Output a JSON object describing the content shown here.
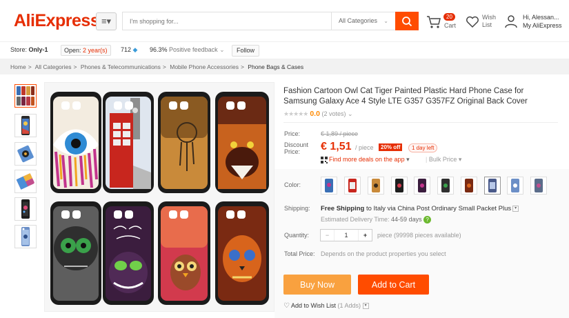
{
  "header": {
    "logo": "AliExpress",
    "logo_mark": "®",
    "search_placeholder": "I'm shopping for...",
    "category_select": "All Categories",
    "cart_count": "20",
    "cart_label": "Cart",
    "wish_line1": "Wish",
    "wish_line2": "List",
    "account_line1": "Hi, Alessan...",
    "account_line2": "My AliExpress",
    "accent_color": "#ff4c00"
  },
  "store": {
    "store_label": "Store:",
    "store_name": "Only-1",
    "open_label": "Open:",
    "open_years": "2 year(s)",
    "score": "712",
    "feedback_pct": "96.3%",
    "feedback_label": "Positive feedback",
    "follow": "Follow"
  },
  "breadcrumb": [
    "Home",
    "All Categories",
    "Phones & Telecommunications",
    "Mobile Phone Accessories",
    "Phone Bags & Cases"
  ],
  "breadcrumb_sep": ">",
  "product": {
    "title": "Fashion Cartoon Owl Cat Tiger Painted Plastic Hard Phone Case for Samsung Galaxy Ace 4 Style LTE G357 G357FZ Original Back Cover",
    "rating": "0.0",
    "votes": "(2 votes)",
    "stars_filled": 0,
    "price_label": "Price:",
    "price_old": "€ 1,89 / piece",
    "discount_label_1": "Discount",
    "discount_label_2": "Price:",
    "price_new": "€ 1,51",
    "per_piece": "/ piece",
    "off": "20% off",
    "day_left": "1 day left",
    "deals": "Find more deals on the app",
    "bulk": "Bulk Price",
    "color_label": "Color:",
    "shipping_label": "Shipping:",
    "shipping_text_1": "Free Shipping",
    "shipping_text_2": " to Italy via China Post Ordinary Small Packet Plus",
    "eta_label": "Estimated Delivery Time:",
    "eta_days": "44-59 days",
    "quantity_label": "Quantity:",
    "quantity": "1",
    "qty_minus": "−",
    "qty_plus": "+",
    "qty_note": "piece (99998 pieces available)",
    "total_label": "Total Price:",
    "total_value": "Depends on the product properties you select",
    "buy_now": "Buy Now",
    "add_to_cart": "Add to Cart",
    "add_wish": "Add to Wish List",
    "wish_adds": "(1 Adds)"
  }
}
